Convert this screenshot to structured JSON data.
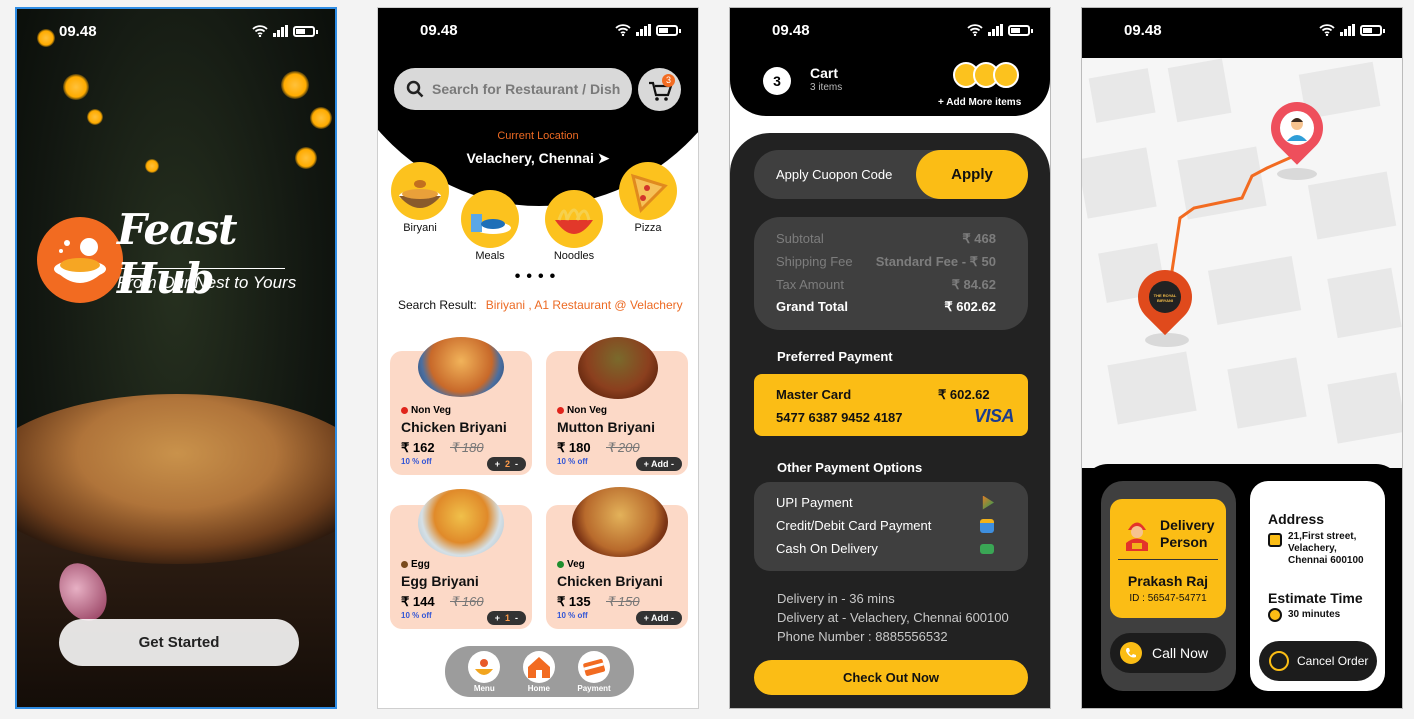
{
  "status": {
    "time": "09.48"
  },
  "splash": {
    "brand": "Feast Hub",
    "tagline": "From Our Nest to Yours",
    "cta": "Get Started"
  },
  "home": {
    "search_placeholder": "Search for Restaurant / Dish",
    "cart_count": "3",
    "location_label": "Current Location",
    "location_value": "Velachery, Chennai",
    "categories": [
      "Biryani",
      "Meals",
      "Noodles",
      "Pizza"
    ],
    "search_result_label": "Search Result:",
    "search_result_value": "Biriyani , A1 Restaurant @ Velachery",
    "items": [
      {
        "tag": "Non Veg",
        "tag_color": "#e0241b",
        "name": "Chicken Briyani",
        "price": "₹ 162",
        "old_price": "₹ 180",
        "discount": "10 % off",
        "action": "+  2  -",
        "qty": "2"
      },
      {
        "tag": "Non Veg",
        "tag_color": "#e0241b",
        "name": "Mutton Briyani",
        "price": "₹ 180",
        "old_price": "₹ 200",
        "discount": "10 % off",
        "action": "+ Add -"
      },
      {
        "tag": "Egg",
        "tag_color": "#7a4a1c",
        "name": "Egg Briyani",
        "price": "₹ 144",
        "old_price": "₹ 160",
        "discount": "10 % off",
        "action": "+  1  -",
        "qty": "1"
      },
      {
        "tag": "Veg",
        "tag_color": "#1e8e2e",
        "name": "Chicken Briyani",
        "price": "₹ 135",
        "old_price": "₹ 150",
        "discount": "10 % off",
        "action": "+ Add -"
      }
    ],
    "nav": [
      "Menu",
      "Home",
      "Payment"
    ]
  },
  "cart": {
    "count": "3",
    "title": "Cart",
    "subtitle": "3 items",
    "add_more": "+ Add More items",
    "coupon_label": "Apply Cuopon Code",
    "apply": "Apply",
    "subtotal_label": "Subtotal",
    "subtotal": "₹ 468",
    "shipping_label": "Shipping Fee",
    "shipping": "Standard Fee - ₹ 50",
    "tax_label": "Tax Amount",
    "tax": "₹ 84.62",
    "grand_label": "Grand Total",
    "grand": "₹ 602.62",
    "preferred_label": "Preferred Payment",
    "card_name": "Master Card",
    "card_amount": "₹ 602.62",
    "card_number": "5477 6387 9452 4187",
    "card_brand": "VISA",
    "other_label": "Other Payment Options",
    "options": [
      "UPI Payment",
      "Credit/Debit Card Payment",
      "Cash On Delivery"
    ],
    "delivery_time": "Delivery in - 36 mins",
    "delivery_at": "Delivery at - Velachery, Chennai 600100",
    "phone": "Phone Number : 8885556532",
    "checkout": "Check Out Now"
  },
  "tracking": {
    "restaurant_pin_text": "THE ROYAL BIRYANI",
    "delivery_title": "Delivery Person",
    "person_name": "Prakash Raj",
    "person_id": "ID : 56547-54771",
    "call": "Call Now",
    "address_label": "Address",
    "address": "21,First street, Velachery, Chennai 600100",
    "eta_label": "Estimate Time",
    "eta": "30 minutes",
    "cancel": "Cancel Order"
  },
  "colors": {
    "accent": "#fbbd15",
    "brand_orange": "#f26b21"
  }
}
